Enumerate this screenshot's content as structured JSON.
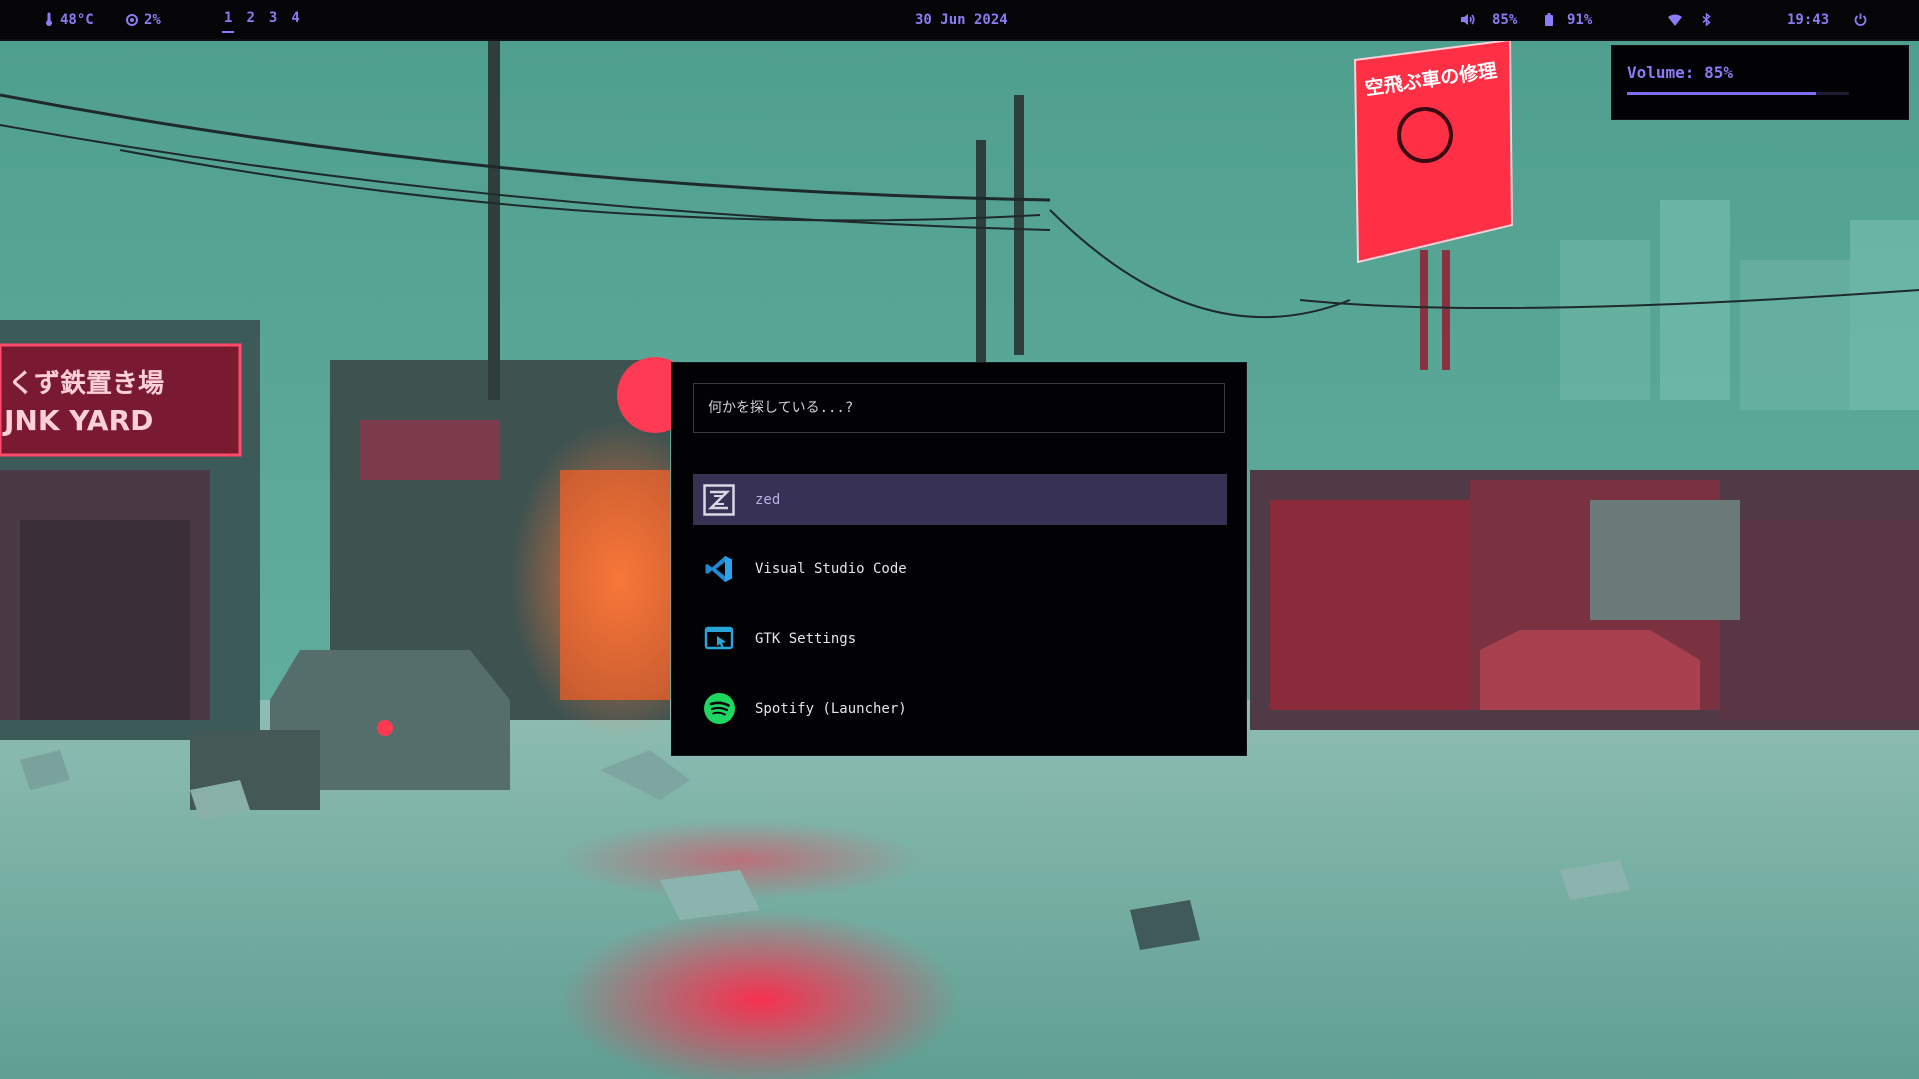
{
  "topbar": {
    "temperature": "48°C",
    "cpu": "2%",
    "workspaces": [
      "1",
      "2",
      "3",
      "4"
    ],
    "active_workspace": "1",
    "date": "30 Jun 2024",
    "volume": "85%",
    "battery": "91%",
    "time": "19:43",
    "icons": [
      "thermometer-icon",
      "cpu-icon",
      "speaker-icon",
      "battery-icon",
      "wifi-icon",
      "bluetooth-icon",
      "power-icon"
    ],
    "accent_color": "#8a7cf4"
  },
  "osd": {
    "label": "Volume: 85%",
    "level": 0.85
  },
  "launcher": {
    "search_placeholder": "何かを探している...?",
    "items": [
      {
        "label": "zed",
        "icon": "zed-icon",
        "selected": true
      },
      {
        "label": "Visual Studio Code",
        "icon": "vscode-icon",
        "selected": false
      },
      {
        "label": "GTK Settings",
        "icon": "gtk-settings-icon",
        "selected": false
      },
      {
        "label": "Spotify (Launcher)",
        "icon": "spotify-icon",
        "selected": false
      }
    ],
    "selection_color": "#373253"
  },
  "wallpaper": {
    "sign_left_line1": "くず鉄置き場",
    "sign_right": "空飛ぶ車の修理"
  }
}
